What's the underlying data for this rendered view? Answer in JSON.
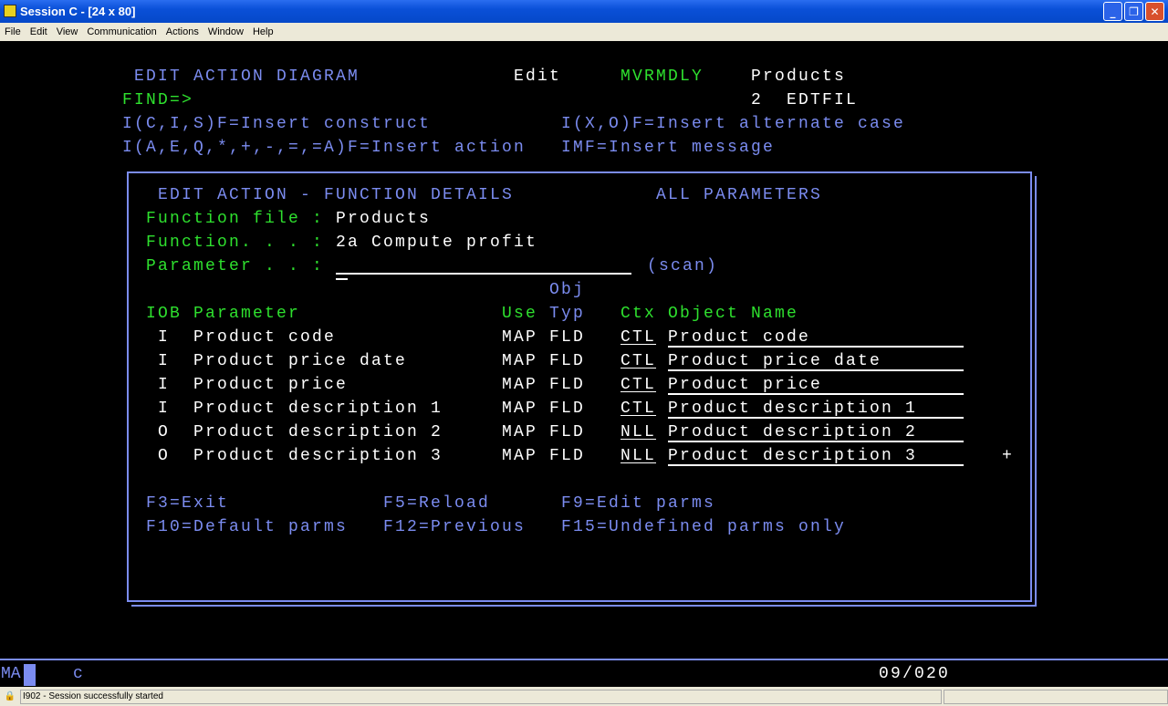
{
  "window": {
    "title": "Session C - [24 x 80]"
  },
  "menu": [
    "File",
    "Edit",
    "View",
    "Communication",
    "Actions",
    "Window",
    "Help"
  ],
  "header": {
    "title": "EDIT ACTION DIAGRAM",
    "mode": "Edit",
    "program": "MVRMDLY",
    "file": "Products",
    "find": "FIND=>",
    "level": "2  EDTFIL",
    "hint1": "I(C,I,S)F=Insert construct",
    "hint2": "I(X,O)F=Insert alternate case",
    "hint3": "I(A,E,Q,*,+,-,=,=A)F=Insert action",
    "hint4": "IMF=Insert message"
  },
  "dialog": {
    "title": "EDIT ACTION - FUNCTION DETAILS",
    "subtitle": "ALL PARAMETERS",
    "file_label": "Function file :",
    "file_value": "Products",
    "function_label": "Function. . . :",
    "function_value": "2a Compute profit",
    "param_label": "Parameter . . :",
    "param_value": "",
    "scan": "(scan)",
    "cols": {
      "obj": "Obj",
      "iob": "IOB",
      "parameter": "Parameter",
      "use": "Use",
      "typ": "Typ",
      "ctx": "Ctx",
      "object_name": "Object Name"
    },
    "rows": [
      {
        "iob": "I",
        "param": "Product code",
        "use": "MAP",
        "typ": "FLD",
        "ctx": "CTL",
        "obj": "Product code"
      },
      {
        "iob": "I",
        "param": "Product price date",
        "use": "MAP",
        "typ": "FLD",
        "ctx": "CTL",
        "obj": "Product price date"
      },
      {
        "iob": "I",
        "param": "Product price",
        "use": "MAP",
        "typ": "FLD",
        "ctx": "CTL",
        "obj": "Product price"
      },
      {
        "iob": "I",
        "param": "Product description 1",
        "use": "MAP",
        "typ": "FLD",
        "ctx": "CTL",
        "obj": "Product description 1"
      },
      {
        "iob": "O",
        "param": "Product description 2",
        "use": "MAP",
        "typ": "FLD",
        "ctx": "NLL",
        "obj": "Product description 2"
      },
      {
        "iob": "O",
        "param": "Product description 3",
        "use": "MAP",
        "typ": "FLD",
        "ctx": "NLL",
        "obj": "Product description 3"
      }
    ],
    "more": "+",
    "keys": [
      "F3=Exit",
      "F5=Reload",
      "F9=Edit parms",
      "F10=Default parms",
      "F12=Previous",
      "F15=Undefined parms only"
    ]
  },
  "oia": {
    "left": "MA",
    "mid": "c",
    "pos": "09/020"
  },
  "status": {
    "message": "I902 - Session successfully started"
  }
}
